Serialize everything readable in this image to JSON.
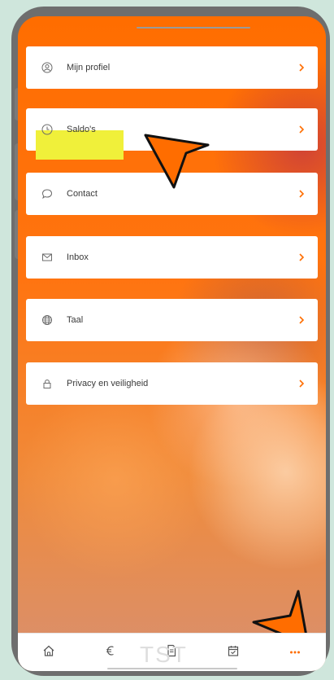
{
  "menu": {
    "items": [
      {
        "label": "Mijn profiel",
        "icon": "user-circle-icon"
      },
      {
        "label": "Saldo's",
        "icon": "clock-icon",
        "highlighted": true
      },
      {
        "label": "Contact",
        "icon": "chat-bubble-icon"
      },
      {
        "label": "Inbox",
        "icon": "envelope-icon"
      },
      {
        "label": "Taal",
        "icon": "globe-icon"
      },
      {
        "label": "Privacy en veiligheid",
        "icon": "lock-icon"
      }
    ]
  },
  "bottom_nav": {
    "items": [
      {
        "icon": "home-icon"
      },
      {
        "icon": "euro-icon"
      },
      {
        "icon": "document-icon"
      },
      {
        "icon": "calendar-icon"
      },
      {
        "icon": "more-dots-icon",
        "active": true
      }
    ],
    "watermark": "TST"
  },
  "colors": {
    "background_orange": "#ff6d00",
    "accent": "#ff6d00",
    "highlight": "#f0f03a",
    "pointer_fill": "#ff6d00"
  }
}
